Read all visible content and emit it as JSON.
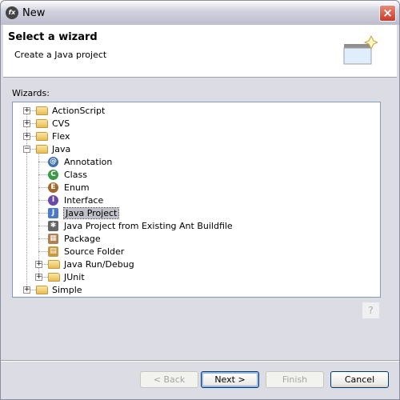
{
  "window": {
    "title": "New",
    "close_icon": "close-icon"
  },
  "header": {
    "title": "Select a wizard",
    "subtitle": "Create a Java project"
  },
  "wizards_label": "Wizards:",
  "tree": [
    {
      "label": "ActionScript",
      "level": 0,
      "expander": "+",
      "icon": "folder"
    },
    {
      "label": "CVS",
      "level": 0,
      "expander": "+",
      "icon": "folder"
    },
    {
      "label": "Flex",
      "level": 0,
      "expander": "+",
      "icon": "folder"
    },
    {
      "label": "Java",
      "level": 0,
      "expander": "-",
      "icon": "folder"
    },
    {
      "label": "Annotation",
      "level": 1,
      "icon": "annotation"
    },
    {
      "label": "Class",
      "level": 1,
      "icon": "class"
    },
    {
      "label": "Enum",
      "level": 1,
      "icon": "enum"
    },
    {
      "label": "Interface",
      "level": 1,
      "icon": "interface"
    },
    {
      "label": "Java Project",
      "level": 1,
      "icon": "java-project",
      "selected": true
    },
    {
      "label": "Java Project from Existing Ant Buildfile",
      "level": 1,
      "icon": "ant"
    },
    {
      "label": "Package",
      "level": 1,
      "icon": "package"
    },
    {
      "label": "Source Folder",
      "level": 1,
      "icon": "source-folder"
    },
    {
      "label": "Java Run/Debug",
      "level": 1,
      "expander": "+",
      "icon": "folder"
    },
    {
      "label": "JUnit",
      "level": 1,
      "expander": "+",
      "icon": "folder"
    },
    {
      "label": "Simple",
      "level": 0,
      "expander": "+",
      "icon": "folder"
    }
  ],
  "buttons": {
    "back": "< Back",
    "next": "Next >",
    "finish": "Finish",
    "cancel": "Cancel"
  }
}
